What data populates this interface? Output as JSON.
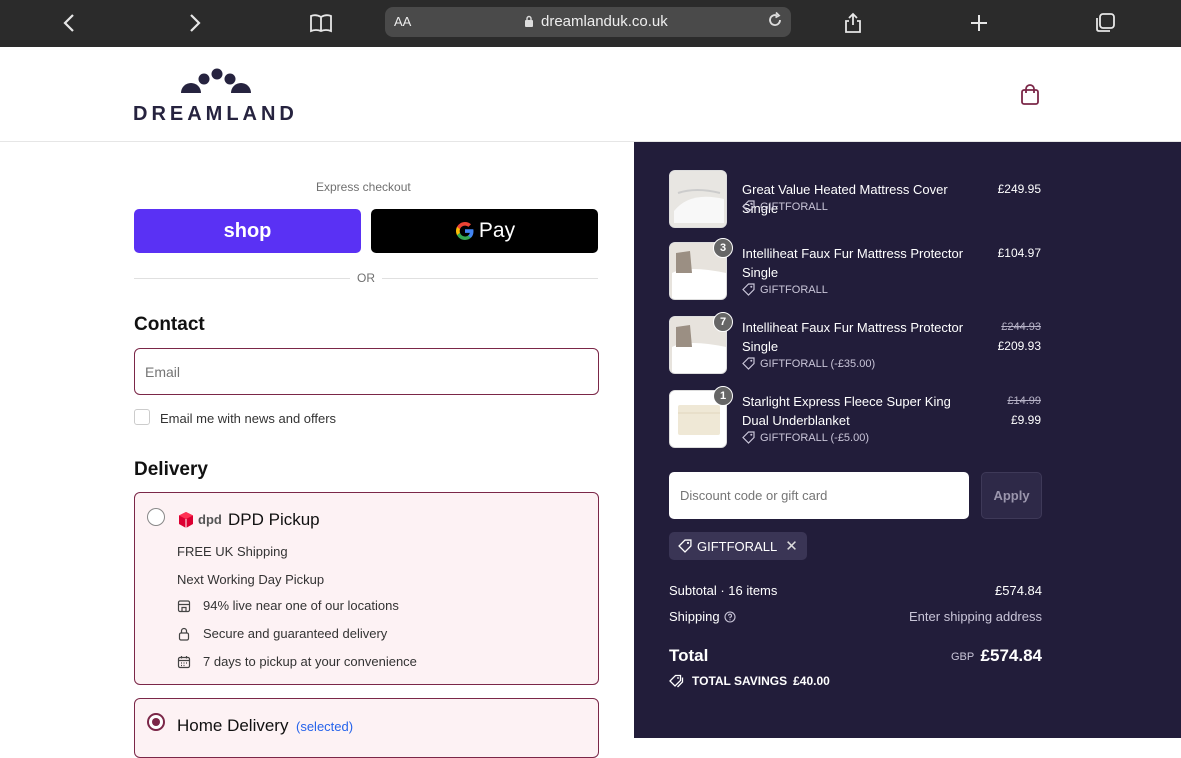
{
  "browser": {
    "aa_label": "AA",
    "url": "dreamlanduk.co.uk",
    "back_icon": "chevron-left-icon",
    "forward_icon": "chevron-right-icon",
    "bookmarks_icon": "book-icon",
    "share_icon": "share-icon",
    "new_tab_icon": "plus-icon",
    "tabs_icon": "tabs-icon"
  },
  "header": {
    "logo_text": "DREAMLAND",
    "cart_icon": "shopping-bag-icon"
  },
  "checkout": {
    "express_label": "Express checkout",
    "shop_label": "shop",
    "gpay_label": "Pay",
    "or_label": "OR",
    "contact_heading": "Contact",
    "email_placeholder": "Email",
    "newsletter_label": "Email me with news and offers",
    "delivery_heading": "Delivery",
    "dpd": {
      "logo_text": "dpd",
      "title": "DPD Pickup",
      "line1": "FREE UK Shipping",
      "line2": "Next Working Day Pickup",
      "feature1": "94% live near one of our locations",
      "feature2": "Secure and guaranteed delivery",
      "feature3": "7 days to pickup at your convenience"
    },
    "home": {
      "title": "Home Delivery",
      "selected_label": "(selected)"
    }
  },
  "summary": {
    "items": [
      {
        "name": "Great Value Heated Mattress Cover Single",
        "code": "GIFTFORALL",
        "price": "£249.95",
        "qty": ""
      },
      {
        "name": "Intelliheat Faux Fur Mattress Protector Single",
        "code": "GIFTFORALL",
        "price": "£104.97",
        "qty": "3"
      },
      {
        "name": "Intelliheat Faux Fur Mattress Protector Single",
        "code": "GIFTFORALL (-£35.00)",
        "old_price": "£244.93",
        "price": "£209.93",
        "qty": "7"
      },
      {
        "name": "Starlight Express Fleece Super King Dual Underblanket",
        "code": "GIFTFORALL (-£5.00)",
        "old_price": "£14.99",
        "price": "£9.99",
        "qty": "1"
      }
    ],
    "discount_placeholder": "Discount code or gift card",
    "apply_label": "Apply",
    "applied_code": "GIFTFORALL",
    "subtotal_label": "Subtotal · 16 items",
    "subtotal_value": "£574.84",
    "shipping_label": "Shipping",
    "shipping_value": "Enter shipping address",
    "total_label": "Total",
    "currency": "GBP",
    "total_value": "£574.84",
    "savings_label": "TOTAL SAVINGS",
    "savings_value": "£40.00"
  },
  "colors": {
    "accent": "#7b2748",
    "summary_bg": "#221d3a",
    "shop_purple": "#5a31f4"
  }
}
